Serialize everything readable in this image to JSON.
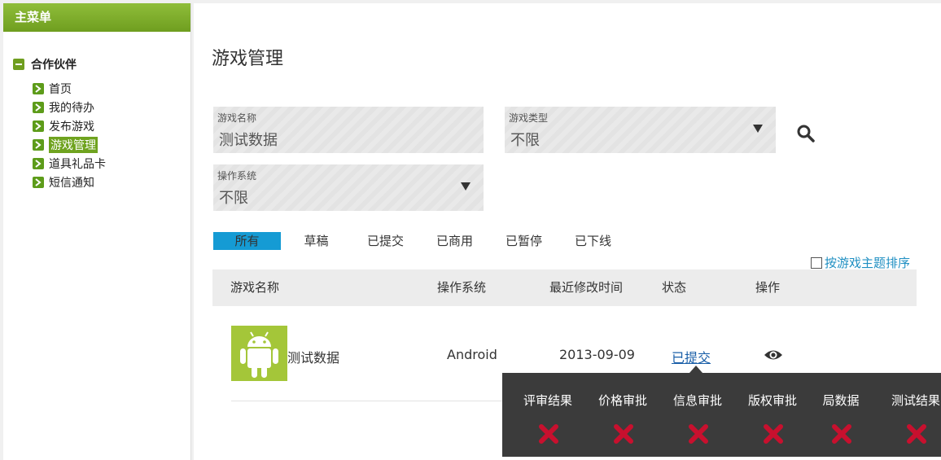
{
  "sidebar": {
    "header": "主菜单",
    "root_label": "合作伙伴",
    "items": [
      {
        "label": "首页"
      },
      {
        "label": "我的待办"
      },
      {
        "label": "发布游戏"
      },
      {
        "label": "游戏管理",
        "active": true
      },
      {
        "label": "道具礼品卡"
      },
      {
        "label": "短信通知"
      }
    ]
  },
  "main": {
    "title": "游戏管理",
    "filters": {
      "game_name": {
        "label": "游戏名称",
        "value": "测试数据"
      },
      "game_type": {
        "label": "游戏类型",
        "value": "不限"
      },
      "os": {
        "label": "操作系统",
        "value": "不限"
      }
    },
    "tabs": [
      "所有",
      "草稿",
      "已提交",
      "已商用",
      "已暂停",
      "已下线"
    ],
    "active_tab": "所有",
    "sort_option": "按游戏主题排序",
    "table": {
      "headers": [
        "游戏名称",
        "操作系统",
        "最近修改时间",
        "状态",
        "操作"
      ],
      "rows": [
        {
          "name": "测试数据",
          "os": "Android",
          "modified": "2013-09-09",
          "status": "已提交",
          "icon": "android-icon",
          "action_icon": "eye-icon"
        }
      ]
    },
    "popup": {
      "items": [
        {
          "label": "评审结果",
          "icon": "red-x-icon"
        },
        {
          "label": "价格审批",
          "icon": "red-x-icon"
        },
        {
          "label": "信息审批",
          "icon": "red-x-icon"
        },
        {
          "label": "版权审批",
          "icon": "red-x-icon"
        },
        {
          "label": "局数据",
          "icon": "red-x-icon"
        },
        {
          "label": "测试结果",
          "icon": "red-x-icon"
        }
      ]
    }
  },
  "colors": {
    "sidebar_green": "#6f9e1f",
    "active_tab_blue": "#159bd4",
    "link_blue": "#1a5fa8",
    "android_green": "#a4c639",
    "error_red": "#c8102e",
    "popup_bg": "#3b3b3b"
  }
}
